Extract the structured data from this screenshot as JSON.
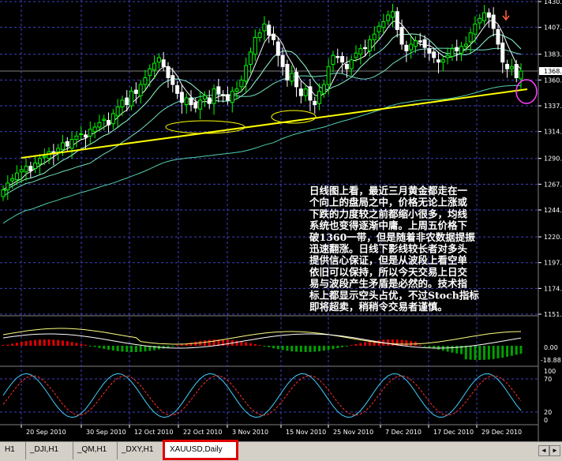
{
  "price_axis": [
    "1430.",
    "1407.",
    "1383.",
    "1360.",
    "1337.",
    "1314.",
    "1290.",
    "1267.",
    "1244.",
    "1220.",
    "1197.",
    "1174.",
    "1151."
  ],
  "current_price": "1368.",
  "osc_axis": [
    "0.00",
    "-18.88"
  ],
  "stoch_axis": [
    "100",
    "70",
    "20",
    "0"
  ],
  "dates": [
    "20 Sep 2010",
    "30 Sep 2010",
    "12 Oct 2010",
    "22 Oct 2010",
    "3 Nov 2010",
    "15 Nov 2010",
    "25 Nov 2010",
    "7 Dec 2010",
    "17 Dec 2010",
    "29 Dec 2010"
  ],
  "annotation": [
    "日线图上看，最近三月黄金都走在一",
    "个向上的盘局之中，价格无论上涨或",
    "下跌的力度较之前都缩小很多，均线",
    "系统也变得逐渐中庸。上周五价格下",
    "破1360一带，但是随着非农数据提振",
    "迅速翻涨。日线下影线较长者对多头",
    "提供信心保证，但是从波段上看空单",
    "依旧可以保持，所以今天交易上日交",
    "易与波段产生矛盾是必然的。技术指",
    "标上都显示空头占优，不过Stoch指标",
    "即将超卖，稍稍令交易者谨慎。"
  ],
  "tabs": [
    {
      "label": "H1"
    },
    {
      "label": "_DJI,H1"
    },
    {
      "label": "_QM,H1"
    },
    {
      "label": "_DXY,H1"
    },
    {
      "label": "XAUUSD,Daily"
    }
  ],
  "chart_data": {
    "type": "candlestick",
    "symbol": "XAUUSD,Daily",
    "ylim": [
      1151,
      1430
    ],
    "dates": [
      "20 Sep 2010",
      "30 Sep 2010",
      "12 Oct 2010",
      "22 Oct 2010",
      "3 Nov 2010",
      "15 Nov 2010",
      "25 Nov 2010",
      "7 Dec 2010",
      "17 Dec 2010",
      "29 Dec 2010"
    ],
    "closes": [
      1262,
      1268,
      1272,
      1277,
      1280,
      1283,
      1279,
      1286,
      1290,
      1292,
      1296,
      1294,
      1299,
      1304,
      1301,
      1307,
      1310,
      1312,
      1309,
      1316,
      1318,
      1322,
      1325,
      1320,
      1330,
      1336,
      1342,
      1338,
      1350,
      1348,
      1356,
      1362,
      1370,
      1375,
      1380,
      1372,
      1362,
      1356,
      1348,
      1340,
      1344,
      1338,
      1335,
      1342,
      1346,
      1339,
      1352,
      1348,
      1346,
      1342,
      1350,
      1352,
      1360,
      1373,
      1385,
      1398,
      1402,
      1410,
      1400,
      1396,
      1382,
      1372,
      1360,
      1366,
      1354,
      1346,
      1352,
      1342,
      1338,
      1350,
      1356,
      1372,
      1382,
      1380,
      1376,
      1370,
      1378,
      1384,
      1388,
      1388,
      1396,
      1401,
      1408,
      1412,
      1418,
      1421,
      1405,
      1392,
      1386,
      1392,
      1395,
      1394,
      1389,
      1384,
      1380,
      1376,
      1378,
      1382,
      1388,
      1386,
      1390,
      1392,
      1402,
      1410,
      1415,
      1420,
      1416,
      1406,
      1392,
      1376,
      1370,
      1372,
      1362,
      1368
    ],
    "support_line": {
      "from": [
        1298,
        1366
      ],
      "points_count": 2
    }
  }
}
